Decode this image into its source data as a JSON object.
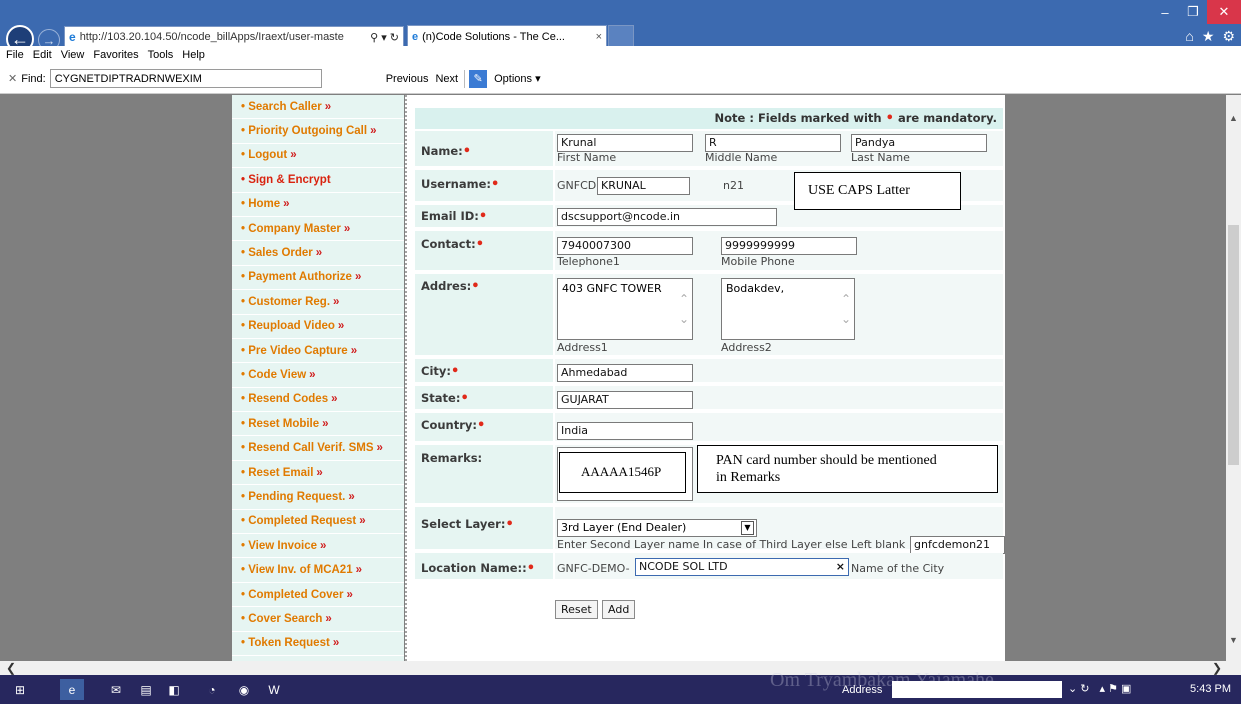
{
  "browser": {
    "url": "http://103.20.104.50/ncode_billApps/Iraext/user-maste",
    "tab_title": "(n)Code Solutions - The Ce...",
    "menu": [
      "File",
      "Edit",
      "View",
      "Favorites",
      "Tools",
      "Help"
    ],
    "find_label": "Find:",
    "find_value": "CYGNETDIPTRADRNWEXIM",
    "find_previous": "Previous",
    "find_next": "Next",
    "find_options": "Options ▾"
  },
  "sidebar": {
    "items": [
      {
        "label": "• Search Caller",
        "arrow": "»",
        "red": false
      },
      {
        "label": "• Priority Outgoing Call",
        "arrow": "»",
        "red": false
      },
      {
        "label": "• Logout",
        "arrow": "»",
        "red": false
      },
      {
        "label": "• Sign & Encrypt",
        "arrow": "",
        "red": true
      },
      {
        "label": "• Home",
        "arrow": "»",
        "red": false
      },
      {
        "label": "• Company Master",
        "arrow": "»",
        "red": false
      },
      {
        "label": "• Sales Order",
        "arrow": "»",
        "red": false
      },
      {
        "label": "• Payment Authorize",
        "arrow": "»",
        "red": false
      },
      {
        "label": "• Customer Reg.",
        "arrow": "»",
        "red": false
      },
      {
        "label": "• Reupload Video",
        "arrow": "»",
        "red": false
      },
      {
        "label": "• Pre Video Capture",
        "arrow": "»",
        "red": false
      },
      {
        "label": "• Code View",
        "arrow": "»",
        "red": false
      },
      {
        "label": "• Resend Codes",
        "arrow": "»",
        "red": false
      },
      {
        "label": "• Reset Mobile",
        "arrow": "»",
        "red": false
      },
      {
        "label": "• Resend Call Verif. SMS",
        "arrow": "»",
        "red": false
      },
      {
        "label": "• Reset Email",
        "arrow": "»",
        "red": false
      },
      {
        "label": "• Pending Request.",
        "arrow": "»",
        "red": false
      },
      {
        "label": "• Completed Request",
        "arrow": "»",
        "red": false
      },
      {
        "label": "• View Invoice",
        "arrow": "»",
        "red": false
      },
      {
        "label": "• View Inv. of MCA21",
        "arrow": "»",
        "red": false
      },
      {
        "label": "• Completed Cover",
        "arrow": "»",
        "red": false
      },
      {
        "label": "• Cover Search",
        "arrow": "»",
        "red": false
      },
      {
        "label": "• Token Request",
        "arrow": "»",
        "red": false
      }
    ]
  },
  "form": {
    "note_prefix": "Note : Fields marked with",
    "note_suffix": "are mandatory.",
    "mandatory_mark": "•",
    "name": {
      "label": "Name:",
      "first": "Krunal",
      "middle": "R",
      "last": "Pandya",
      "first_caption": "First Name",
      "middle_caption": "Middle Name",
      "last_caption": "Last Name"
    },
    "username": {
      "label": "Username:",
      "prefix": "GNFCD",
      "value": "KRUNAL",
      "suffix": "n21",
      "annotation": "USE CAPS Latter"
    },
    "email": {
      "label": "Email ID:",
      "value": "dscsupport@ncode.in"
    },
    "contact": {
      "label": "Contact:",
      "telephone": "7940007300",
      "mobile": "9999999999",
      "telephone_caption": "Telephone1",
      "mobile_caption": "Mobile Phone"
    },
    "address": {
      "label": "Addres:",
      "address1": "403 GNFC TOWER",
      "address2": "Bodakdev,",
      "address1_caption": "Address1",
      "address2_caption": "Address2"
    },
    "city": {
      "label": "City:",
      "value": "Ahmedabad"
    },
    "state": {
      "label": "State:",
      "value": "GUJARAT"
    },
    "country": {
      "label": "Country:",
      "value": "India"
    },
    "remarks": {
      "label": "Remarks:",
      "value": "AAAAA1546P",
      "annotation_line1": "PAN card number should be mentioned",
      "annotation_line2": "in Remarks"
    },
    "layer": {
      "label": "Select Layer:",
      "selected": "3rd Layer (End Dealer)",
      "hint": "Enter Second Layer name In case of Third Layer else Left blank",
      "second_layer_value": "gnfcdemon21"
    },
    "location": {
      "label": "Location Name::",
      "prefix": "GNFC-DEMO-",
      "value": "NCODE SOL LTD",
      "clear": "×",
      "hint": "Name of the City"
    },
    "reset_label": "Reset",
    "add_label": "Add"
  },
  "taskbar": {
    "address_label": "Address",
    "watermark": "Om Tryambakam Yajamahe",
    "clock": "5:43 PM"
  }
}
